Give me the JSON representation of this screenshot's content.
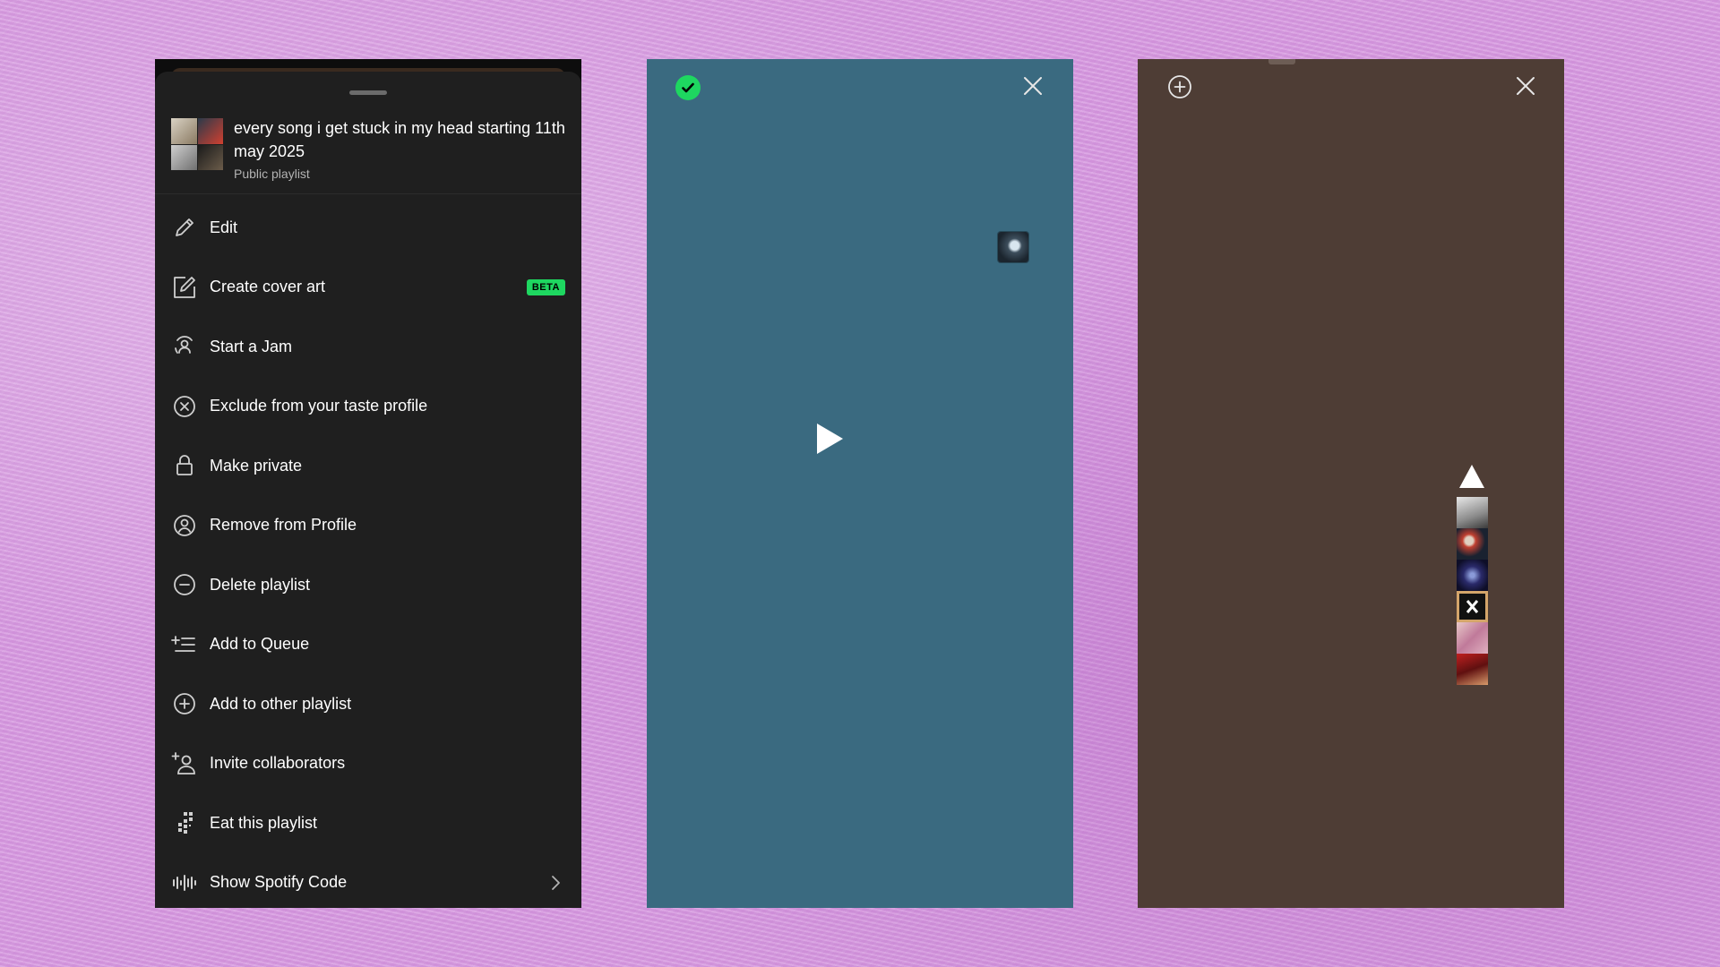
{
  "menu_panel": {
    "playlist": {
      "title": "every song i get stuck in my head starting 11th may 2025",
      "subtitle": "Public playlist"
    },
    "items": [
      {
        "label": "Edit",
        "icon": "pencil-icon"
      },
      {
        "label": "Create cover art",
        "icon": "cover-art-icon",
        "badge": "BETA"
      },
      {
        "label": "Start a Jam",
        "icon": "jam-icon"
      },
      {
        "label": "Exclude from your taste profile",
        "icon": "exclude-icon"
      },
      {
        "label": "Make private",
        "icon": "lock-icon"
      },
      {
        "label": "Remove from Profile",
        "icon": "profile-icon"
      },
      {
        "label": "Delete playlist",
        "icon": "minus-circle-icon"
      },
      {
        "label": "Add to Queue",
        "icon": "queue-icon"
      },
      {
        "label": "Add to other playlist",
        "icon": "plus-circle-icon"
      },
      {
        "label": "Invite collaborators",
        "icon": "invite-icon"
      },
      {
        "label": "Eat this playlist",
        "icon": "eat-icon"
      },
      {
        "label": "Show Spotify Code",
        "icon": "spotify-code-icon"
      }
    ],
    "colors": {
      "background": "#1f1f1f",
      "badge": "#1ed760",
      "text": "#ffffff",
      "subtext": "#b3b3b3"
    }
  },
  "video_panel": {
    "background": "#3a6a80",
    "check_icon": "check-circle-icon",
    "close_icon": "close-icon",
    "play_icon": "play-icon"
  },
  "brown_panel": {
    "background": "#4e3d35",
    "add_icon": "plus-circle-icon",
    "close_icon": "close-icon",
    "thumbnail_count": 6
  },
  "page_background": "#d79ae0"
}
